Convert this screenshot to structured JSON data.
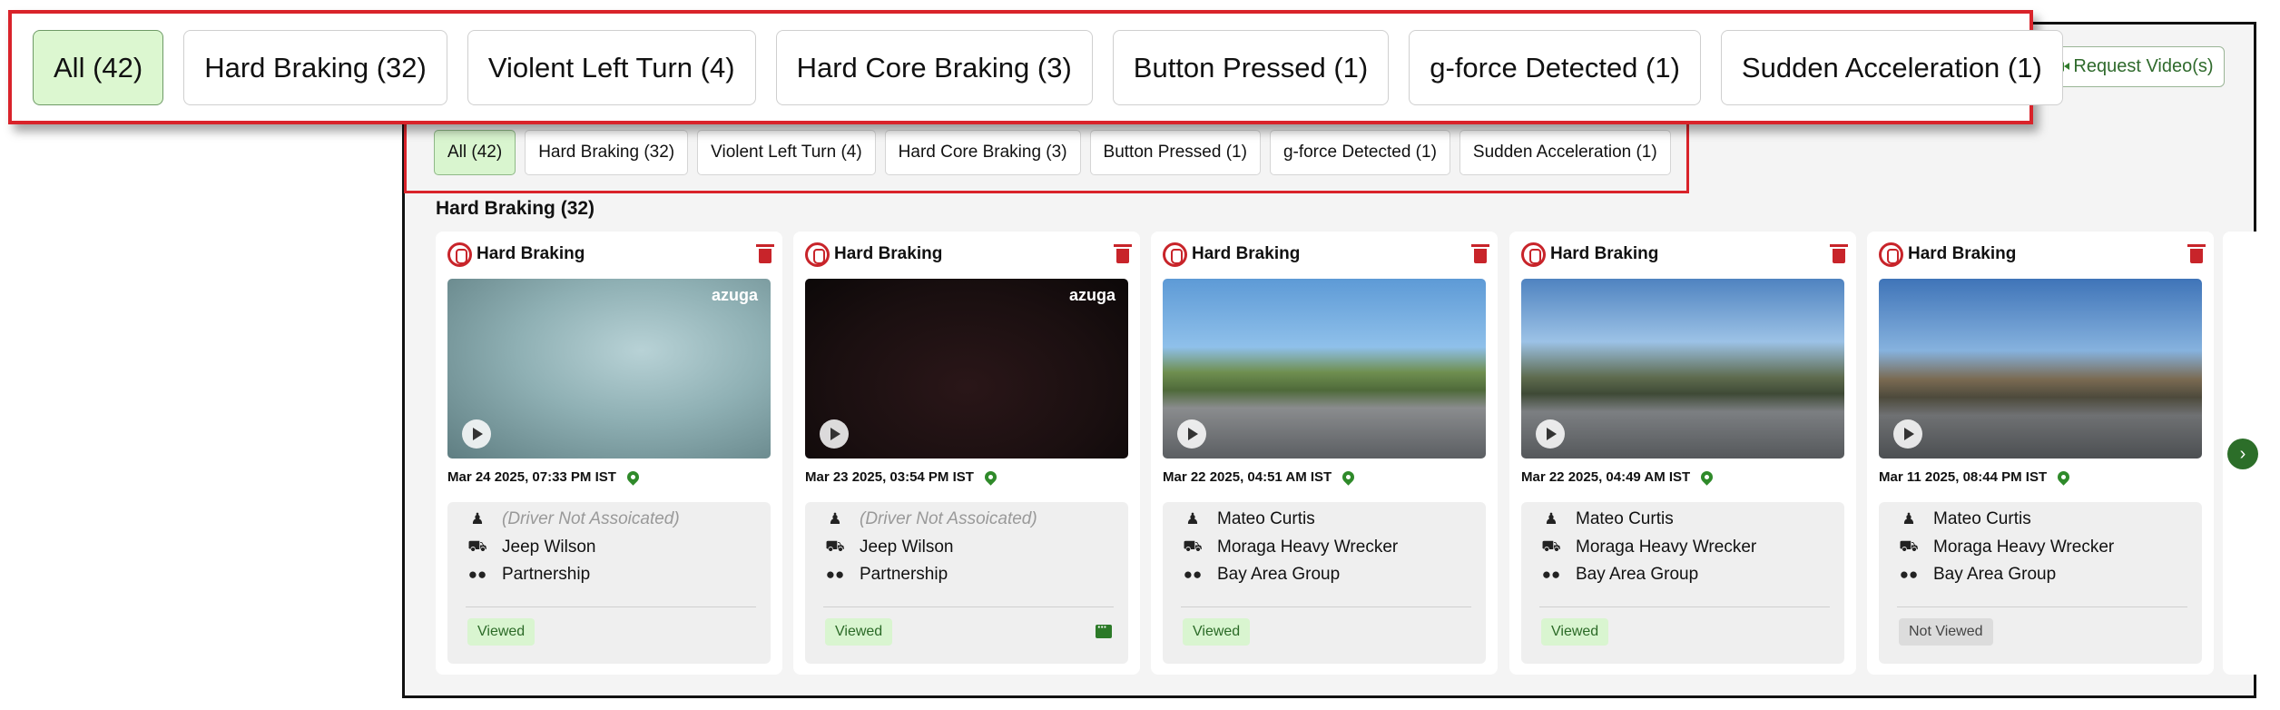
{
  "colors": {
    "accent_green": "#2f6a2c",
    "active_chip_bg": "#d9f5cf",
    "highlight_red": "#d9232a",
    "event_red": "#c8242a"
  },
  "toolbar": {
    "request_video_label": "Request Video(s)"
  },
  "filters": [
    {
      "label": "All (42)",
      "active": true
    },
    {
      "label": "Hard Braking (32)",
      "active": false
    },
    {
      "label": "Violent Left Turn (4)",
      "active": false
    },
    {
      "label": "Hard Core Braking (3)",
      "active": false
    },
    {
      "label": "Button Pressed (1)",
      "active": false
    },
    {
      "label": "g-force Detected (1)",
      "active": false
    },
    {
      "label": "Sudden Acceleration (1)",
      "active": false
    }
  ],
  "section": {
    "title": "Hard Braking (32)"
  },
  "cards": [
    {
      "event": "Hard Braking",
      "timestamp": "Mar 24 2025, 07:33 PM IST",
      "driver": "(Driver Not Assoicated)",
      "vehicle": "Jeep Wilson",
      "group": "Partnership",
      "status": "Viewed",
      "watermark": "azuga"
    },
    {
      "event": "Hard Braking",
      "timestamp": "Mar 23 2025, 03:54 PM IST",
      "driver": "(Driver Not Assoicated)",
      "vehicle": "Jeep Wilson",
      "group": "Partnership",
      "status": "Viewed",
      "watermark": "azuga"
    },
    {
      "event": "Hard Braking",
      "timestamp": "Mar 22 2025, 04:51 AM IST",
      "driver": "Mateo Curtis",
      "vehicle": "Moraga Heavy Wrecker",
      "group": "Bay Area Group",
      "status": "Viewed"
    },
    {
      "event": "Hard Braking",
      "timestamp": "Mar 22 2025, 04:49 AM IST",
      "driver": "Mateo Curtis",
      "vehicle": "Moraga Heavy Wrecker",
      "group": "Bay Area Group",
      "status": "Viewed"
    },
    {
      "event": "Hard Braking",
      "timestamp": "Mar 11 2025, 08:44 PM IST",
      "driver": "Mateo Curtis",
      "vehicle": "Moraga Heavy Wrecker",
      "group": "Bay Area Group",
      "status": "Not Viewed"
    }
  ]
}
